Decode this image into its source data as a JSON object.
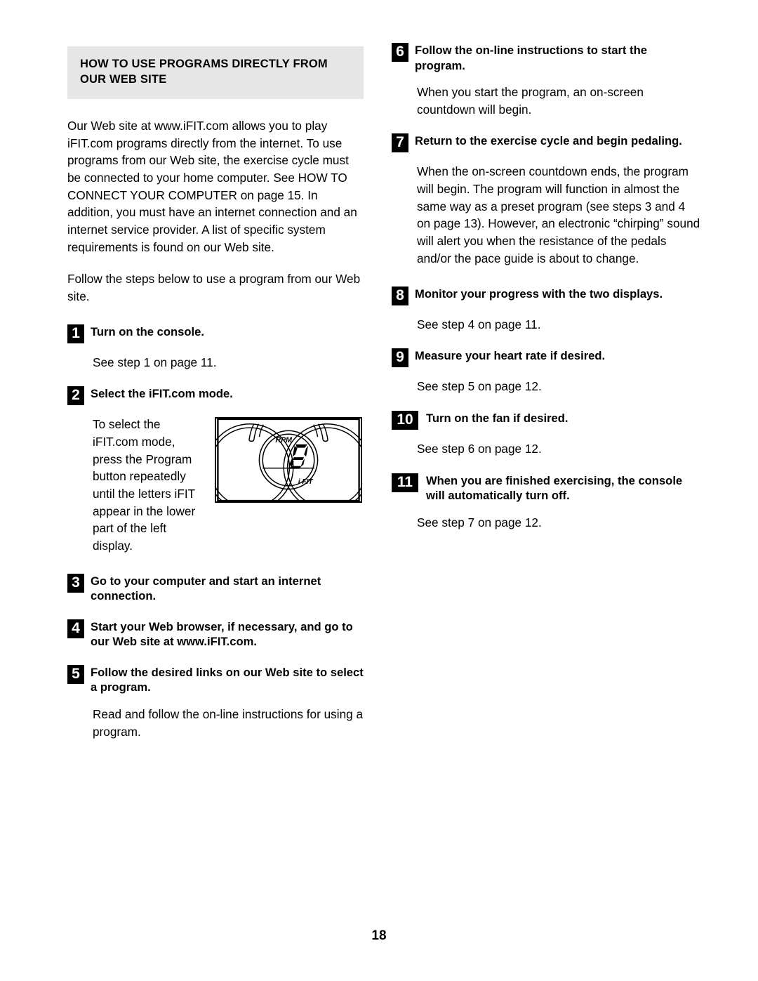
{
  "page": {
    "number": "18"
  },
  "left_column": {
    "section_header": "HOW TO USE PROGRAMS DIRECTLY FROM OUR WEB SITE",
    "intro_paragraph_1": "Our Web site at www.iFIT.com allows you to play iFIT.com programs directly from the internet. To use programs from our Web site, the exercise cycle must be connected to your home computer. See HOW TO CONNECT YOUR COMPUTER on page 15. In addition, you must have an internet connection and an internet service provider. A list of specific system requirements is found on our Web site.",
    "intro_paragraph_2": "Follow the steps below to use a program from our Web site.",
    "steps": [
      {
        "number": "1",
        "title": "Turn on the console.",
        "body": "See step 1 on page 11."
      },
      {
        "number": "2",
        "title": "Select the iFIT.com mode.",
        "body": "To select the iFIT.com mode, press the Program button repeatedly until the letters iFIT appear in the lower part of the left display."
      },
      {
        "number": "3",
        "title": "Go to your computer and start an internet connection.",
        "body": ""
      },
      {
        "number": "4",
        "title": "Start your Web browser, if necessary, and go to our Web site at www.iFIT.com.",
        "body": ""
      },
      {
        "number": "5",
        "title": "Follow the desired links on our Web site to select a program.",
        "body": "Read and follow the on-line instructions for using a program."
      }
    ],
    "figure": {
      "name": "console-display-figure",
      "rpm_label": "RPM",
      "digit_value": "0",
      "ifit_label": "i FIT"
    }
  },
  "right_column": {
    "steps": [
      {
        "number": "6",
        "title": "Follow the on-line instructions to start the program.",
        "body": "When you start the program, an on-screen countdown will begin."
      },
      {
        "number": "7",
        "title": "Return to the exercise cycle and begin pedaling.",
        "body": "When the on-screen countdown ends, the program will begin. The program will function in almost the same way as a preset program (see steps 3 and 4 on page 13). However, an electronic “chirping” sound will alert you when the resistance of the pedals and/or the pace guide is about to change."
      },
      {
        "number": "8",
        "title": "Monitor your progress with the two displays.",
        "body": "See step 4 on page 11."
      },
      {
        "number": "9",
        "title": "Measure your heart rate if desired.",
        "body": "See step 5 on page 12."
      },
      {
        "number": "10",
        "title": "Turn on the fan if desired.",
        "body": "See step 6 on page 12."
      },
      {
        "number": "11",
        "title": "When you are finished exercising, the console will automatically turn off.",
        "body": "See step 7 on page 12."
      }
    ]
  },
  "colors": {
    "header_background": "#e6e6e6",
    "step_badge_background": "#000000",
    "text": "#000000",
    "page_background": "#ffffff"
  }
}
